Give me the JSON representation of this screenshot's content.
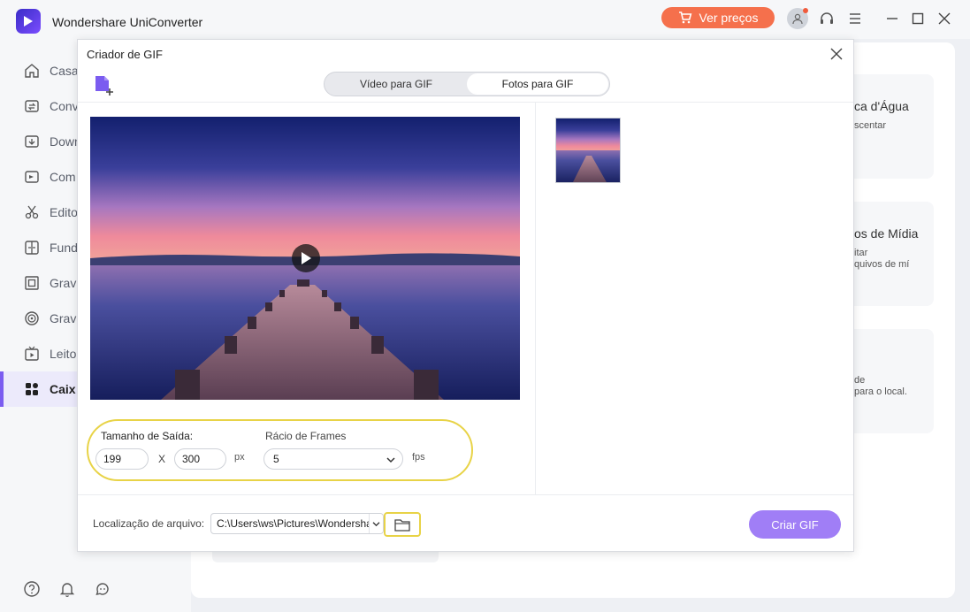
{
  "app": {
    "title": "Wondershare UniConverter",
    "prices_label": "Ver preços"
  },
  "sidebar": {
    "items": [
      {
        "label": "Casa",
        "icon": "home-icon"
      },
      {
        "label": "Conv",
        "icon": "convert-icon"
      },
      {
        "label": "Down",
        "icon": "download-icon"
      },
      {
        "label": "Com",
        "icon": "compress-icon"
      },
      {
        "label": "Edito",
        "icon": "scissors-icon"
      },
      {
        "label": "Fund",
        "icon": "merge-icon"
      },
      {
        "label": "Grava",
        "icon": "screen-record-icon"
      },
      {
        "label": "Grava",
        "icon": "dvd-burn-icon"
      },
      {
        "label": "Leito",
        "icon": "player-icon"
      },
      {
        "label": "Caix",
        "icon": "toolbox-icon"
      }
    ],
    "active_index": 9
  },
  "background": {
    "card1_title": "ca d'Água",
    "card1_sub": "scentar",
    "card2_title": "os de Mídia",
    "card2_sub1": "itar",
    "card2_sub2": "quivos de mí",
    "card3_sub1": "de",
    "card3_sub2": "para o local."
  },
  "dialog": {
    "title": "Criador de GIF",
    "tabs": [
      "Vídeo para GIF",
      "Fotos para GIF"
    ],
    "active_tab": 1,
    "output_size_label": "Tamanho de Saída:",
    "width_value": "199",
    "x_label": "X",
    "height_value": "300",
    "px_label": "px",
    "frame_rate_label": "Rácio de Frames",
    "frame_rate_value": "5",
    "fps_label": "fps",
    "location_label": "Localização de arquivo:",
    "location_value": "C:\\Users\\ws\\Pictures\\Wondershare",
    "create_label": "Criar GIF"
  },
  "colors": {
    "accent": "#7b5cf0",
    "create_button": "#a07ef6",
    "prices_button": "#f5704c",
    "highlight": "#e8d347"
  }
}
